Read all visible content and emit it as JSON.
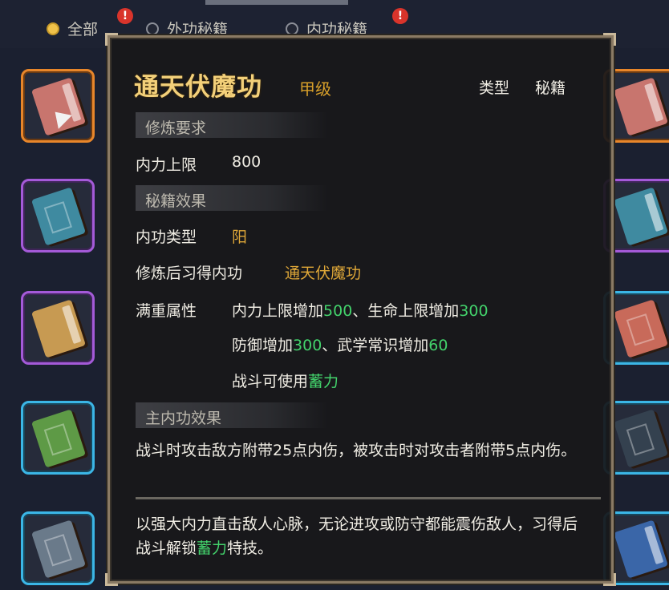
{
  "filters": [
    {
      "label": "全部",
      "selected": true,
      "alert": "!"
    },
    {
      "label": "外功秘籍",
      "selected": false,
      "alert": ""
    },
    {
      "label": "内功秘籍",
      "selected": false,
      "alert": "!"
    }
  ],
  "tooltip": {
    "name": "通天伏魔功",
    "grade": "甲级",
    "type_label": "类型",
    "type_value": "秘籍",
    "sec_requirements": "修炼要求",
    "req_label": "内力上限",
    "req_value": "800",
    "sec_effects": "秘籍效果",
    "neigong_type_label": "内功类型",
    "neigong_type_value": "阳",
    "learn_label": "修炼后习得内功",
    "learn_value": "通天伏魔功",
    "full_label": "满重属性",
    "line1_a": "内力上限增加",
    "line1_v1": "500",
    "line1_b": "、生命上限增加",
    "line1_v2": "300",
    "line2_a": "防御增加",
    "line2_v1": "300",
    "line2_b": "、武学常识增加",
    "line2_v2": "60",
    "line3_a": "战斗可使用",
    "line3_skill": "蓄力",
    "sec_main": "主内功效果",
    "main_effect": "战斗时攻击敌方附带25点内伤，被攻击时对攻击者附带5点内伤。",
    "desc_a": "以强大内力直击敌人心脉，无论进攻或防守都能震伤敌人，习得后战斗解锁",
    "desc_skill": "蓄力",
    "desc_b": "特技。"
  },
  "colors": {
    "gold": "#e0a838",
    "green": "#43d36c",
    "title": "#f3d07a"
  }
}
